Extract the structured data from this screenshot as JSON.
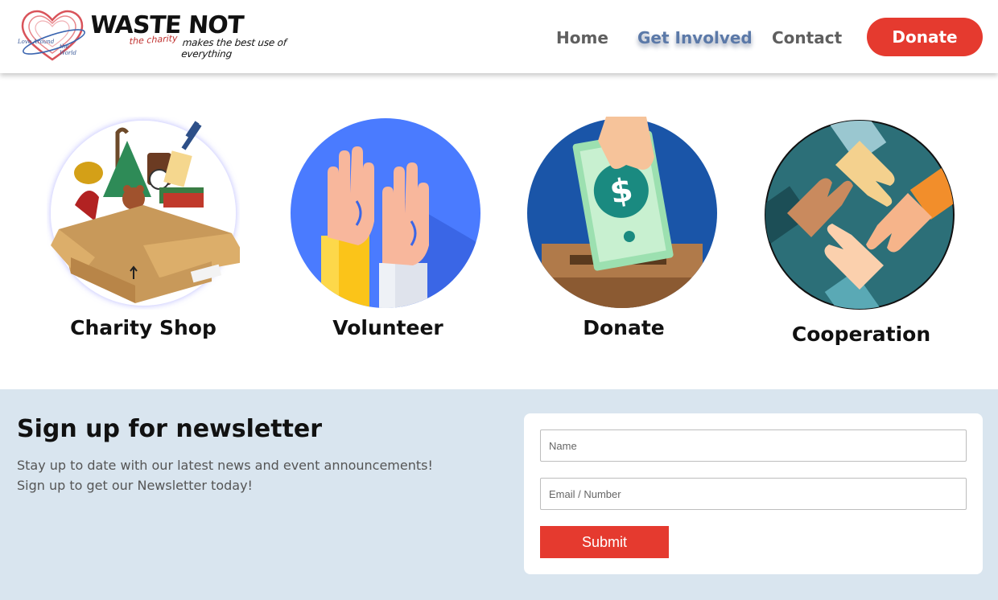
{
  "brand": {
    "wordmark": "WASTE NOT",
    "tagline": "the charity",
    "slogan": "makes the best use of everything",
    "mark_text_left": "Love Around",
    "mark_text_right": "the World"
  },
  "nav": {
    "home": "Home",
    "get_involved": "Get Involved",
    "contact": "Contact",
    "donate": "Donate"
  },
  "features": [
    {
      "label": "Charity Shop",
      "icon": "charity-box-icon"
    },
    {
      "label": "Volunteer",
      "icon": "raised-hands-icon"
    },
    {
      "label": "Donate",
      "icon": "money-donation-icon"
    },
    {
      "label": "Cooperation",
      "icon": "cooperation-hands-icon"
    }
  ],
  "newsletter": {
    "title": "Sign up for newsletter",
    "text": "Stay up to date with our latest news and event announcements! Sign up to get our Newsletter today!",
    "name_placeholder": "Name",
    "email_placeholder": "Email / Number",
    "submit": "Submit"
  },
  "colors": {
    "accent": "#e53a2f",
    "nav_active": "#5b79a8",
    "newsletter_bg": "#d9e5ef"
  }
}
